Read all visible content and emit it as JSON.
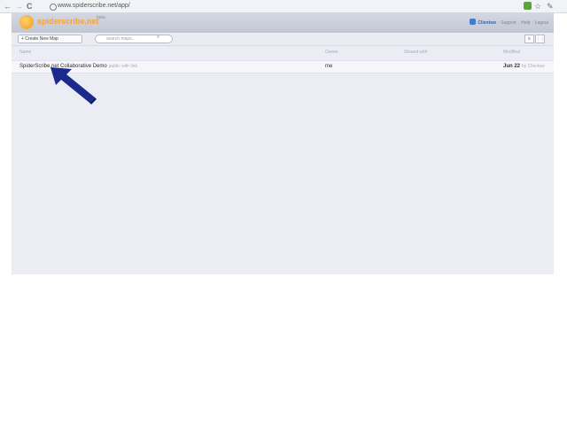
{
  "browser": {
    "url": "www.spiderscribe.net/app/",
    "back": "←",
    "forward": "→",
    "reload": "C"
  },
  "app": {
    "logo_text": "spiderscribe.net",
    "beta": "beta",
    "user": "Clientsw",
    "links": [
      "Support",
      "Help",
      "Logout"
    ]
  },
  "toolbar": {
    "create_label": "+ Create New Map",
    "search_placeholder": "search maps..."
  },
  "table": {
    "headers": [
      "Name",
      "Owner",
      "Shared with",
      "Modified"
    ],
    "rows": [
      {
        "name": "SpiderScribe.net Collaborative Demo",
        "visibility": "public with link",
        "owner": "me",
        "shared": "",
        "modified_date": "Jun 22",
        "modified_by": "by Clientsw"
      }
    ]
  },
  "colors": {
    "accent_orange": "#f7a23a",
    "arrow_blue": "#1a2a8c"
  }
}
